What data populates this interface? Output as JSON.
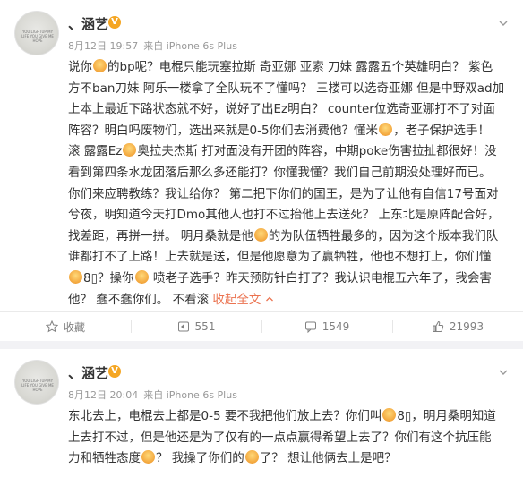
{
  "posts": [
    {
      "username": "、涵艺",
      "verified": "V",
      "time": "8月12日 19:57",
      "source": "来自 iPhone 6s Plus",
      "avatar_text": "YOU LIGHTUP MY LIFE YOU GIVE ME HOPE",
      "lines": [
        [
          "说你",
          "E",
          "的bp呢？电棍只能玩塞拉斯 奇亚娜 亚索 刀妹 露露五个英雄明白？ 紫色"
        ],
        [
          "方不ban刀妹 阿乐一楼拿了全队玩不了懂吗？ 三楼可以选奇亚娜 但是中野双ad加"
        ],
        [
          "上本上最近下路状态就不好，说好了出Ez明白？ counter位选奇亚娜打不了对面"
        ],
        [
          "阵容？明白吗废物们，选出来就是0-5你们去消费他？懂米",
          "E",
          "，老子保护选手！"
        ],
        [
          "滚 露露Ez",
          "E",
          "奥拉夫杰斯 打对面没有开团的阵容，中期poke伤害拉扯都很好！没"
        ],
        [
          "看到第四条水龙团落后那么多还能打？你懂我懂？我们自己前期没处理好而已。"
        ],
        [
          "你们来应聘教练？我让给你？ 第二把下你们的国王，是为了让他有自信17号面对"
        ],
        [
          "兮夜，明知道今天打Dmo其他人也打不过抬他上去送死？ 上东北是原阵配合好，"
        ],
        [
          "找差距，再拼一拼。 明月桑就是他",
          "E",
          "的为队伍牺牲最多的，因为这个版本我们队"
        ],
        [
          "谁都打不了上路！上去就是送，但是他愿意为了赢牺牲，他也不想打上，你们懂"
        ],
        [
          "E",
          "8▯？操你",
          "E",
          " 喷老子选手？昨天预防针白打了？我认识电棍五六年了，我会害"
        ],
        [
          "他？ 蠢不蠢你们。 不看滚 ",
          "X",
          "收起全文 ",
          "A"
        ]
      ],
      "expand_label": "收起全文",
      "actions": {
        "bookmark": "收藏",
        "repost": "551",
        "comment": "1549",
        "like": "21993"
      }
    },
    {
      "username": "、涵艺",
      "verified": "V",
      "time": "8月12日 20:04",
      "source": "来自 iPhone 6s Plus",
      "avatar_text": "YOU LIGHTUP MY LIFE YOU GIVE ME HOPE",
      "lines": [
        [
          "东北去上，电棍去上都是0-5 要不我把他们放上去？你们叫",
          "E",
          "8▯，明月桑明知道"
        ],
        [
          "上去打不过，但是他还是为了仅有的一点点赢得希望上去了？你们有这个抗压能"
        ],
        [
          "力和牺牲态度",
          "E",
          "？ 我操了你们的",
          "E",
          "了？ 想让他俩去上是吧？"
        ]
      ]
    }
  ],
  "colors": {
    "link": "#eb7350",
    "badge": "#f5a623",
    "meta": "#999999"
  }
}
